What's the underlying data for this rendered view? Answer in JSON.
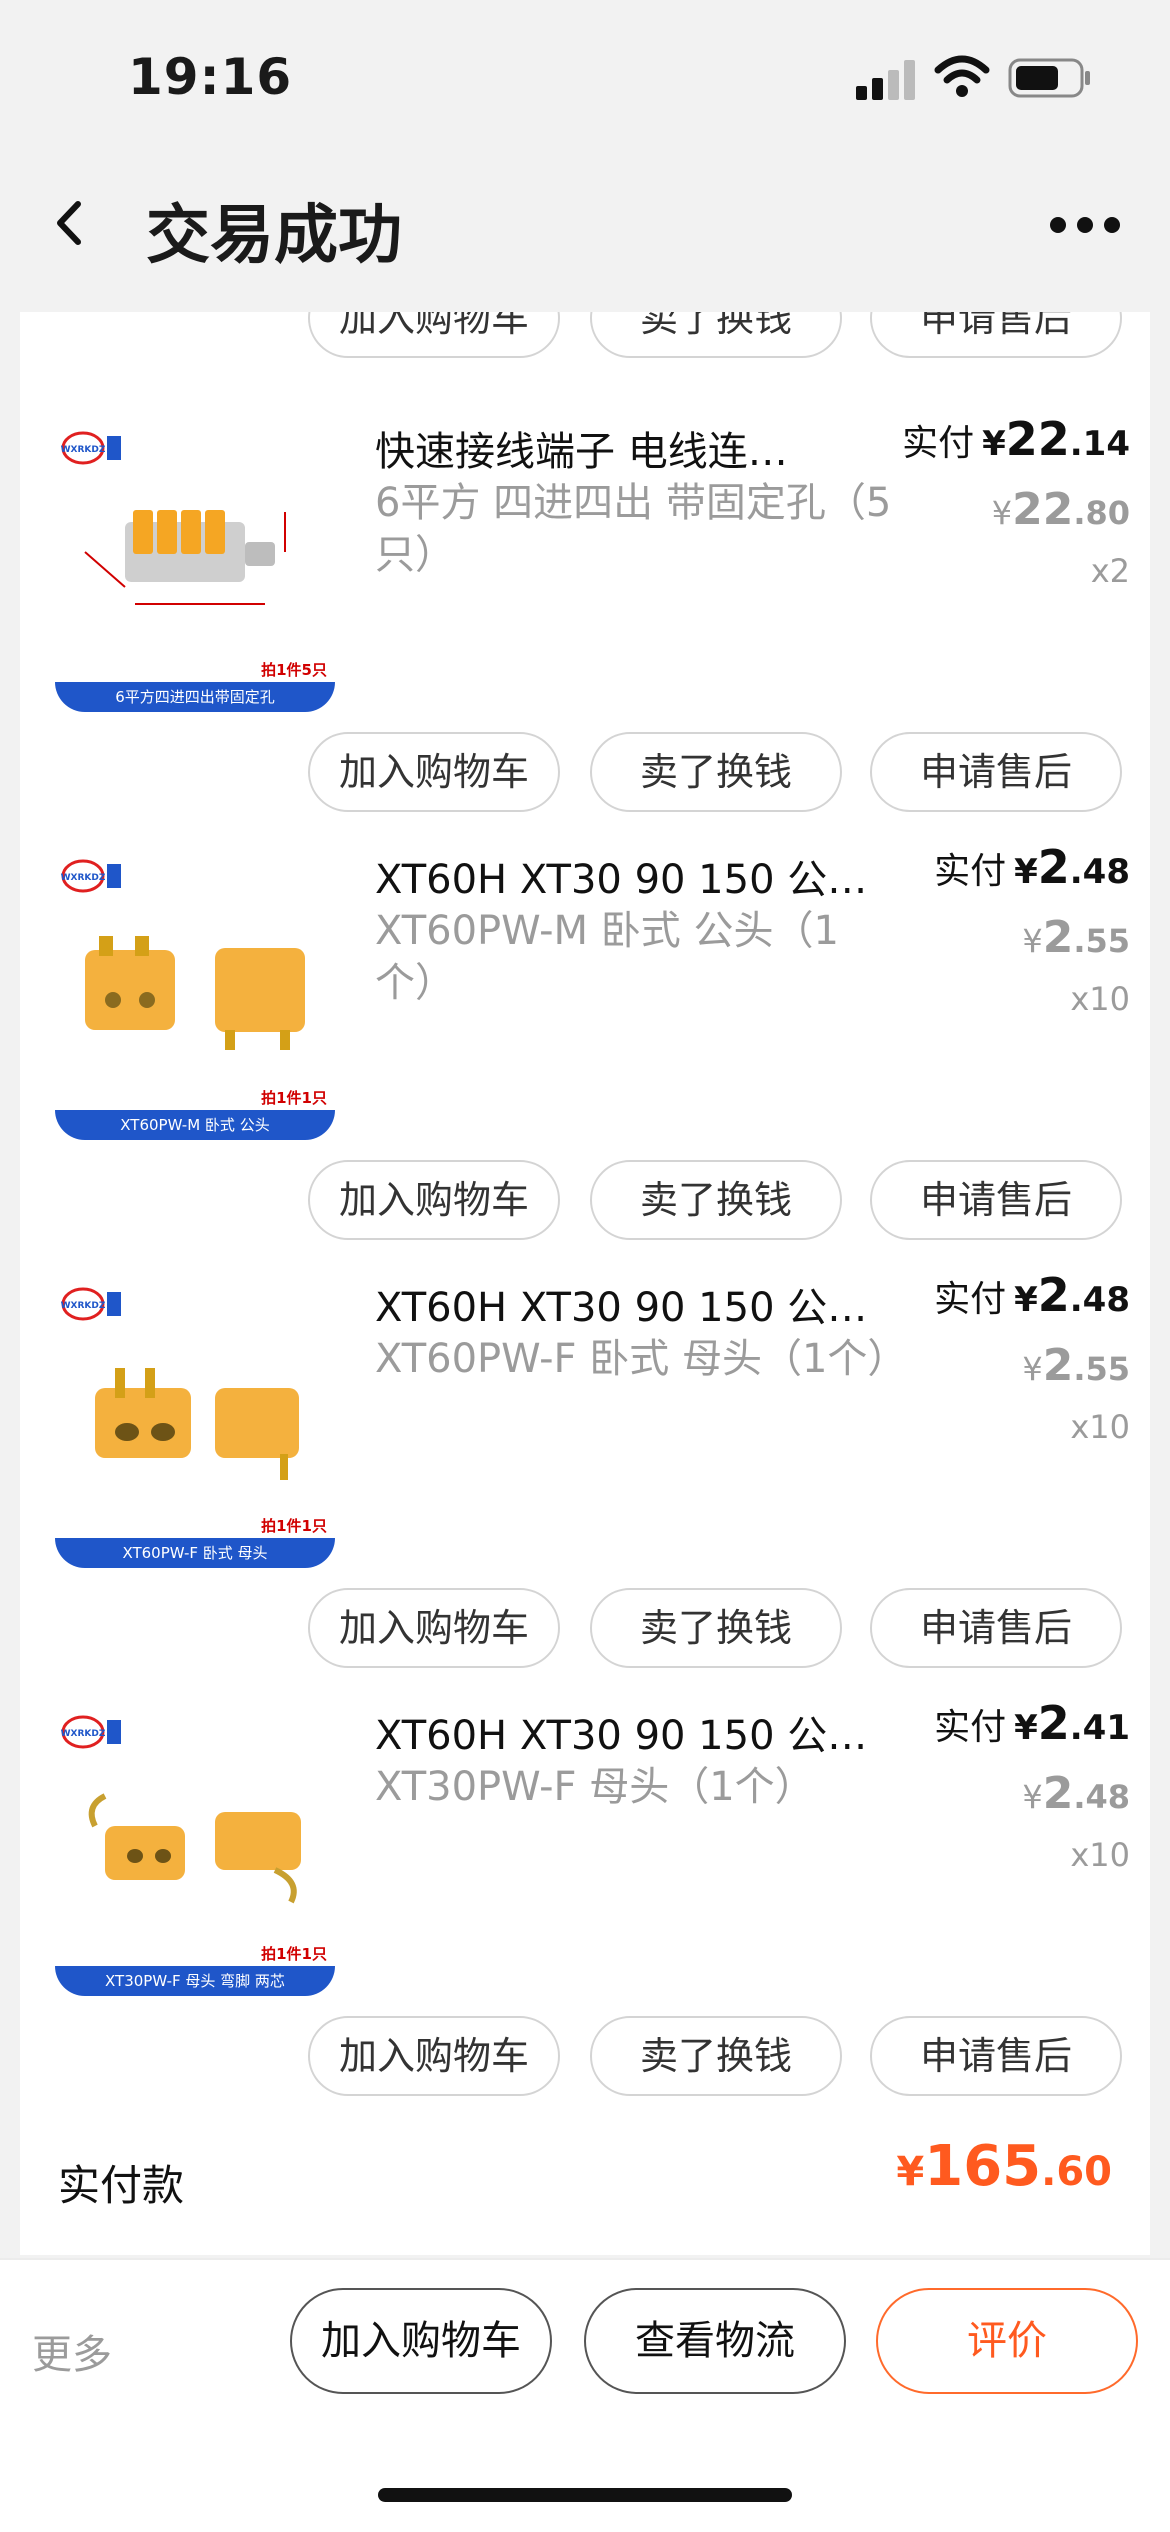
{
  "status_bar": {
    "time": "19:16"
  },
  "nav": {
    "title": "交易成功"
  },
  "actions": {
    "add_cart": "加入购物车",
    "sell": "卖了换钱",
    "after_sale": "申请售后"
  },
  "items": [
    {
      "name": "快速接线端子 电线连…",
      "spec": "6平方 四进四出 带固定孔（5只）",
      "paid_label": "实付",
      "paid_yen": "¥",
      "paid_int": "22",
      "paid_dec": ".14",
      "orig_yen": "¥",
      "orig_int": "22",
      "orig_dec": ".80",
      "qty": "x2",
      "thumb": {
        "brand": "WXRKDZ",
        "banner": "6平方四进四出带固定孔",
        "tag": "拍1件5只",
        "color": "#f5a623"
      }
    },
    {
      "name": "XT60H XT30 90 150 公…",
      "spec": "XT60PW-M 卧式 公头（1个）",
      "paid_label": "实付",
      "paid_yen": "¥",
      "paid_int": "2",
      "paid_dec": ".48",
      "orig_yen": "¥",
      "orig_int": "2",
      "orig_dec": ".55",
      "qty": "x10",
      "thumb": {
        "brand": "WXRKDZ",
        "banner": "XT60PW-M 卧式 公头",
        "tag": "拍1件1只",
        "color": "#f4b13e"
      }
    },
    {
      "name": "XT60H XT30 90 150 公…",
      "spec": "XT60PW-F 卧式 母头（1个）",
      "paid_label": "实付",
      "paid_yen": "¥",
      "paid_int": "2",
      "paid_dec": ".48",
      "orig_yen": "¥",
      "orig_int": "2",
      "orig_dec": ".55",
      "qty": "x10",
      "thumb": {
        "brand": "WXRKDZ",
        "banner": "XT60PW-F 卧式 母头",
        "tag": "拍1件1只",
        "color": "#f4b13e"
      }
    },
    {
      "name": "XT60H XT30 90 150 公…",
      "spec": "XT30PW-F 母头（1个）",
      "paid_label": "实付",
      "paid_yen": "¥",
      "paid_int": "2",
      "paid_dec": ".41",
      "orig_yen": "¥",
      "orig_int": "2",
      "orig_dec": ".48",
      "qty": "x10",
      "thumb": {
        "brand": "WXRKDZ",
        "banner": "XT30PW-F 母头 弯脚 两芯",
        "tag": "拍1件1只",
        "color": "#f4b13e"
      }
    }
  ],
  "total": {
    "label": "实付款",
    "yen": "¥",
    "int": "165",
    "dec": ".60"
  },
  "bottom": {
    "more": "更多",
    "add_cart": "加入购物车",
    "logistics": "查看物流",
    "review": "评价"
  },
  "colors": {
    "accent": "#ff5a1f",
    "banner_blue": "#1f56c9",
    "muted": "#9b9b9b"
  }
}
